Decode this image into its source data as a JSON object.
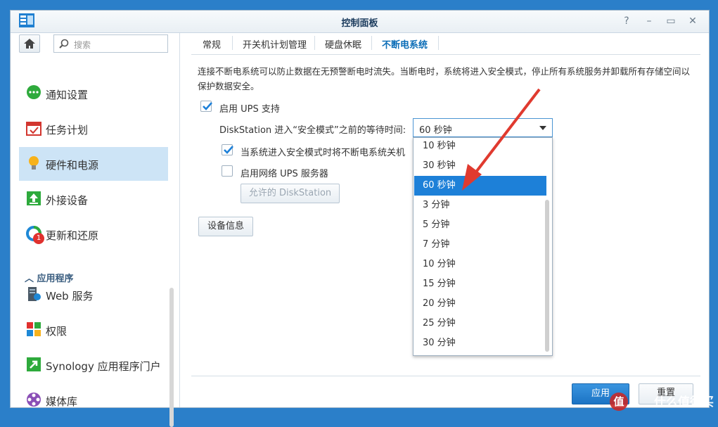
{
  "window": {
    "title": "控制面板"
  },
  "sidebar": {
    "search_placeholder": "搜索",
    "items": [
      {
        "label": "通知设置",
        "icon": "chat-bubble-icon"
      },
      {
        "label": "任务计划",
        "icon": "calendar-icon"
      },
      {
        "label": "硬件和电源",
        "icon": "lightbulb-icon"
      },
      {
        "label": "外接设备",
        "icon": "upload-arrow-icon"
      },
      {
        "label": "更新和还原",
        "icon": "refresh-icon",
        "badge": "1"
      }
    ],
    "section_label": "应用程序",
    "app_items": [
      {
        "label": "Web 服务",
        "icon": "server-icon"
      },
      {
        "label": "权限",
        "icon": "grid-lock-icon"
      },
      {
        "label": "Synology 应用程序门户",
        "icon": "portal-arrow-icon"
      },
      {
        "label": "媒体库",
        "icon": "film-reel-icon"
      }
    ]
  },
  "tabs": [
    "常规",
    "开关机计划管理",
    "硬盘休眠",
    "不断电系统"
  ],
  "active_tab": "不断电系统",
  "ups": {
    "description": "连接不断电系统可以防止数据在无预警断电时流失。当断电时，系统将进入安全模式，停止所有系统服务并卸载所有存储空间以保护数据安全。",
    "enable_label": "启用 UPS 支持",
    "wait_label": "DiskStation 进入“安全模式”之前的等待时间:",
    "wait_value": "60 秒钟",
    "shutdown_label": "当系统进入安全模式时将不断电系统关机",
    "network_label": "启用网络 UPS 服务器",
    "allow_button": "允许的 DiskStation",
    "device_info_button": "设备信息"
  },
  "dropdown_options": [
    "10 秒钟",
    "30 秒钟",
    "60 秒钟",
    "3 分钟",
    "5 分钟",
    "7 分钟",
    "10 分钟",
    "15 分钟",
    "20 分钟",
    "25 分钟",
    "30 分钟"
  ],
  "footer": {
    "apply": "应用",
    "reset": "重置"
  },
  "watermark": {
    "text": "什么值得买",
    "logo": "值"
  },
  "colors": {
    "accent": "#1d80d8",
    "arrow": "#e03a2f"
  }
}
